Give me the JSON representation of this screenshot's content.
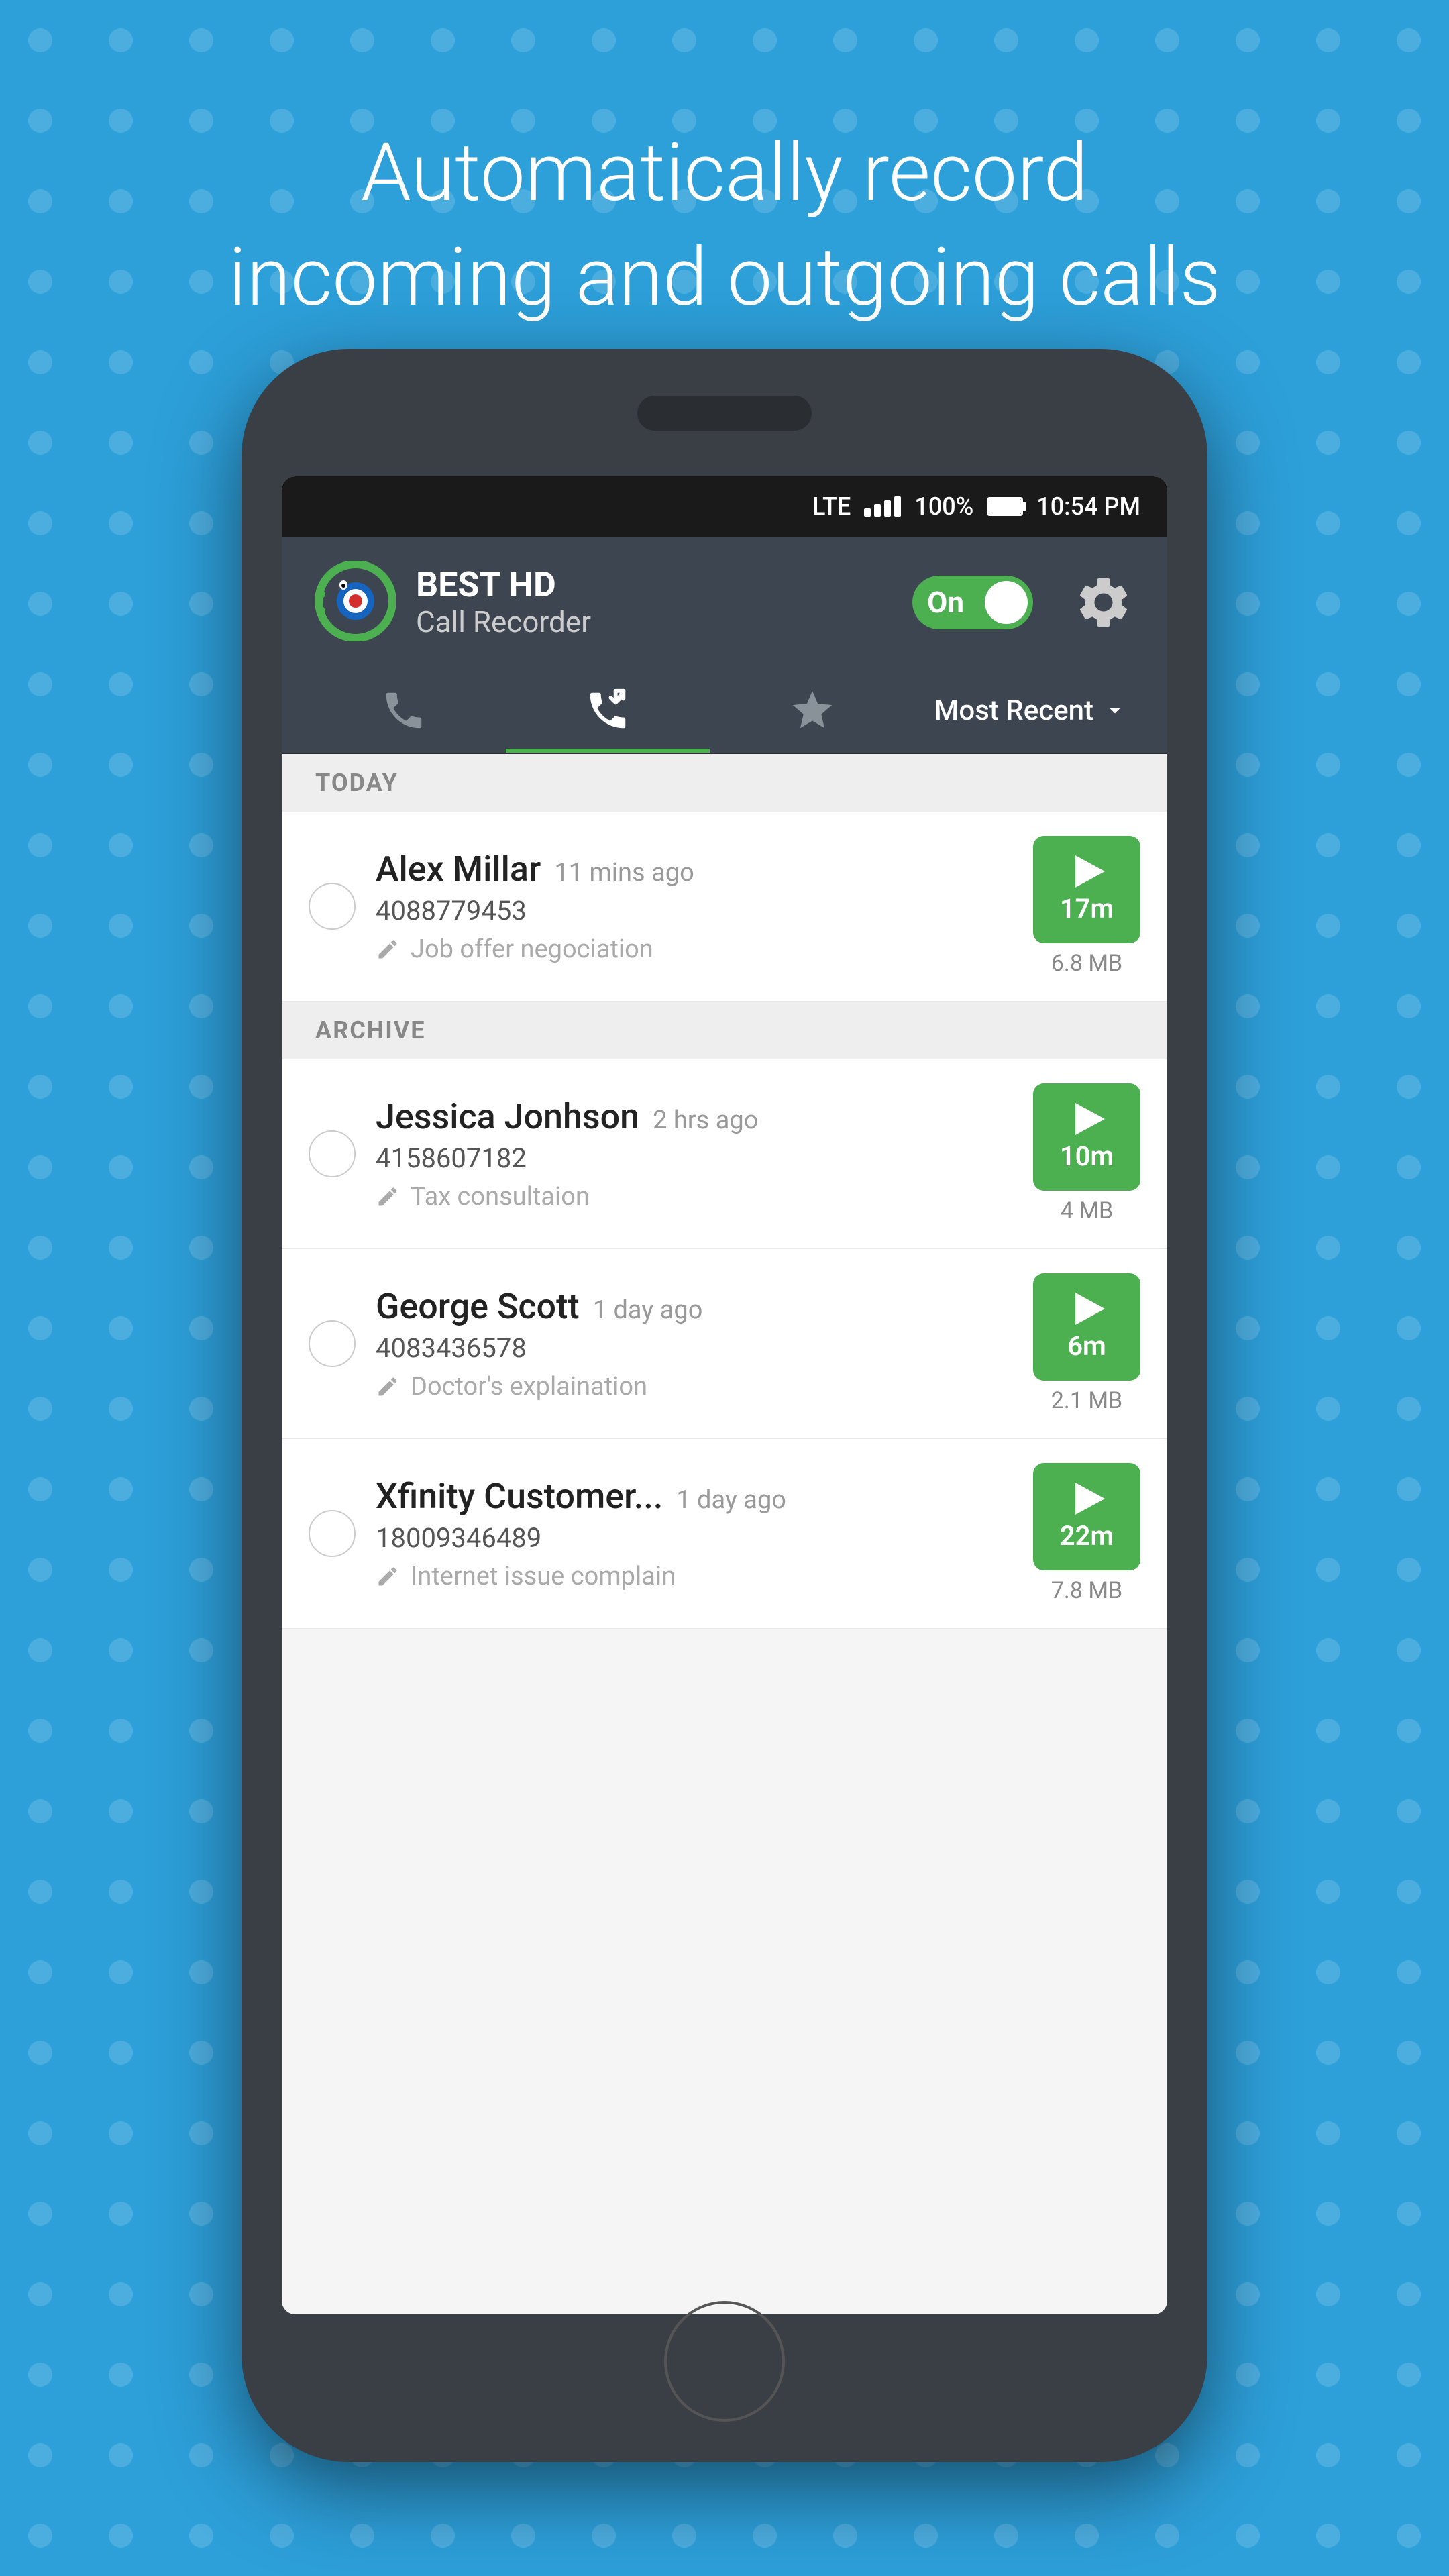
{
  "headline": {
    "line1": "Automatically record",
    "line2": "incoming and outgoing calls"
  },
  "status_bar": {
    "network": "LTE",
    "signal": "signal",
    "battery": "100%",
    "time": "10:54 PM"
  },
  "app_header": {
    "title": "BEST HD",
    "subtitle": "Call Recorder",
    "toggle_label": "On",
    "settings_label": "settings"
  },
  "tabs": [
    {
      "id": "incoming",
      "label": "Incoming calls",
      "active": false
    },
    {
      "id": "outgoing",
      "label": "Outgoing calls",
      "active": true
    },
    {
      "id": "starred",
      "label": "Starred",
      "active": false
    }
  ],
  "sort": {
    "label": "Most Recent",
    "dropdown": "dropdown"
  },
  "sections": [
    {
      "header": "TODAY",
      "calls": [
        {
          "name": "Alex Millar",
          "time_ago": "11 mins ago",
          "number": "4088779453",
          "note": "Job offer negociation",
          "duration": "17m",
          "size": "6.8 MB"
        }
      ]
    },
    {
      "header": "ARCHIVE",
      "calls": [
        {
          "name": "Jessica Jonhson",
          "time_ago": "2 hrs ago",
          "number": "4158607182",
          "note": "Tax consultaion",
          "duration": "10m",
          "size": "4 MB"
        },
        {
          "name": "George Scott",
          "time_ago": "1 day ago",
          "number": "4083436578",
          "note": "Doctor's explaination",
          "duration": "6m",
          "size": "2.1 MB"
        },
        {
          "name": "Xfinity Customer...",
          "time_ago": "1 day ago",
          "number": "18009346489",
          "note": "Internet issue complain",
          "duration": "22m",
          "size": "7.8 MB"
        }
      ]
    }
  ],
  "colors": {
    "background": "#2d9fd9",
    "phone_frame": "#3a3f45",
    "app_header": "#3d4550",
    "toggle_bg": "#4caf50",
    "play_bg": "#4caf50",
    "status_bar": "#1a1a1a"
  }
}
